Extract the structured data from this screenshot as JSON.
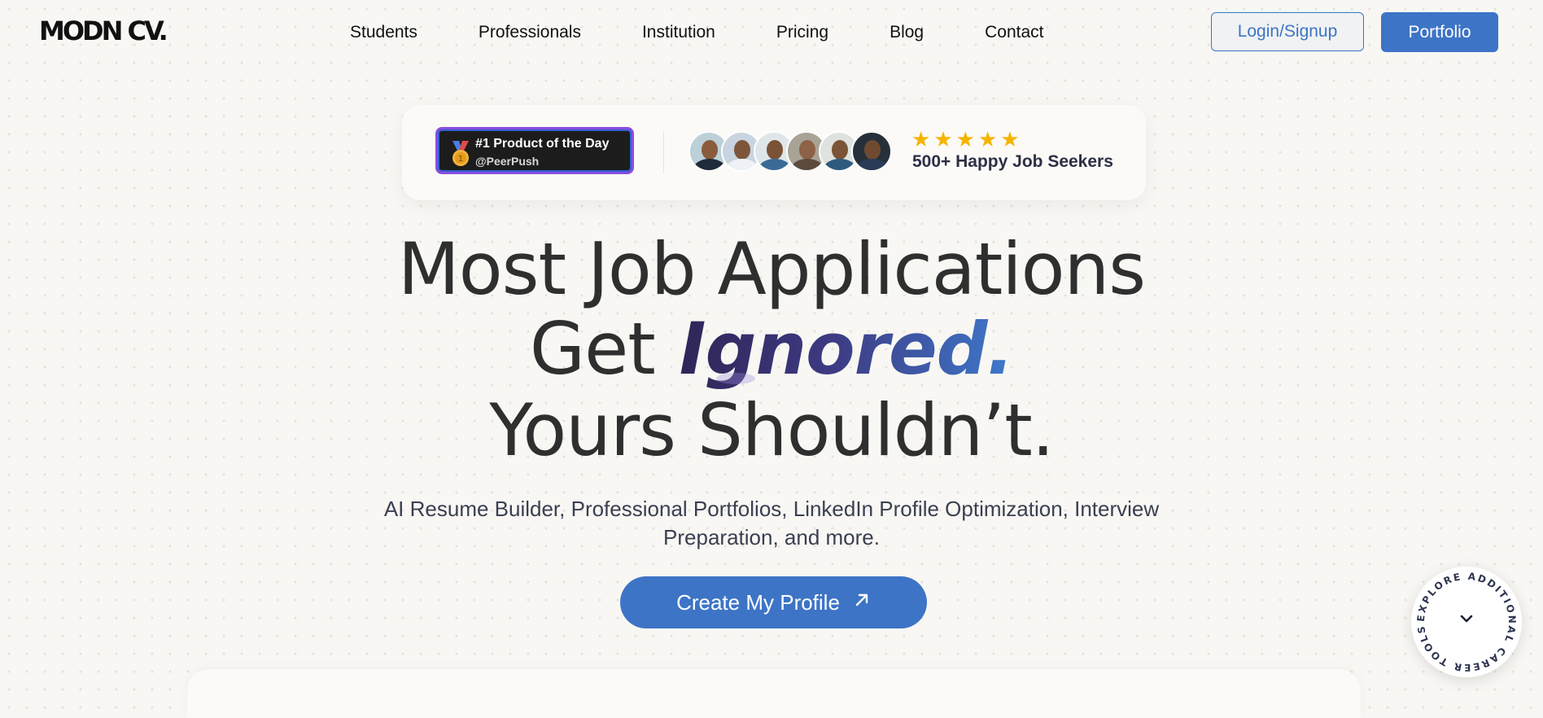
{
  "nav": {
    "logo": "MODN CV.",
    "links": [
      "Students",
      "Professionals",
      "Institution",
      "Pricing",
      "Blog",
      "Contact"
    ],
    "login_label": "Login/Signup",
    "portfolio_label": "Portfolio"
  },
  "badge": {
    "title": "#1 Product of the Day",
    "source": "@PeerPush",
    "icon": "medal-icon",
    "stars": 5,
    "happy_text": "500+ Happy Job Seekers"
  },
  "hero": {
    "line1": "Most Job Applications",
    "line2_prefix": "Get",
    "line2_highlight": "Ignored.",
    "line3": "Yours Shouldn’t.",
    "subtext": "AI Resume Builder, Professional Portfolios, LinkedIn Profile Optimization, Interview Preparation, and more.",
    "cta_label": "Create My Profile",
    "cta_icon": "arrow-up-right-icon"
  },
  "explore": {
    "text": "EXPLORE ADDITIONAL CAREER TOOLS •",
    "icon": "chevron-down-icon"
  },
  "colors": {
    "accent": "#3d74c6",
    "background": "#f8f7f3",
    "badge_border": "#8a4ee0",
    "star": "#f5b400",
    "highlight_start": "#2f2556",
    "highlight_end": "#3f79cc"
  }
}
